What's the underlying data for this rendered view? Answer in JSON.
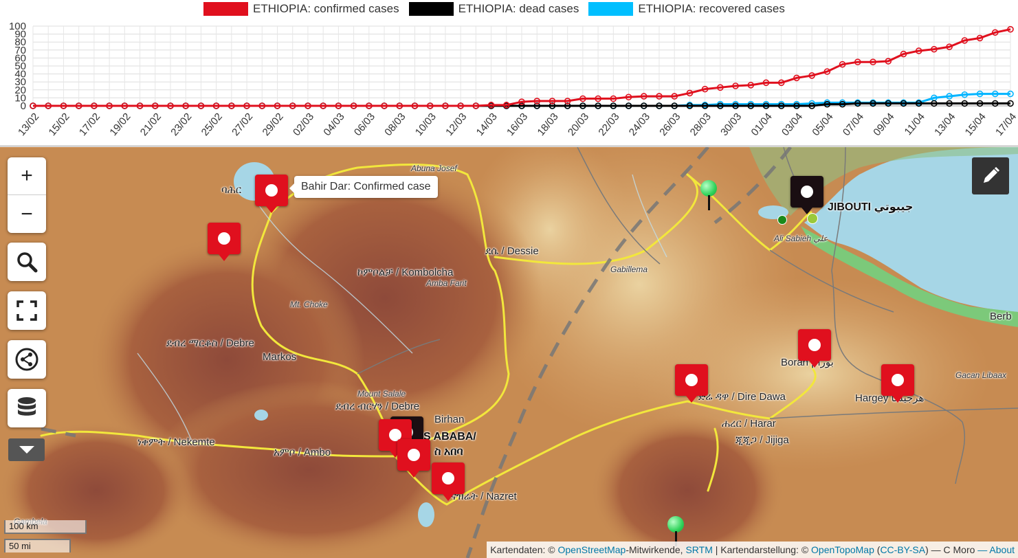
{
  "legend": {
    "confirmed": "ETHIOPIA: confirmed cases",
    "dead": "ETHIOPIA: dead cases",
    "recovered": "ETHIOPIA: recovered cases"
  },
  "chart_data": {
    "type": "line",
    "title": "",
    "xlabel": "",
    "ylabel": "",
    "ylim": [
      0,
      100
    ],
    "yticks": [
      0,
      10,
      20,
      30,
      40,
      50,
      60,
      70,
      80,
      90,
      100
    ],
    "grid": true,
    "legend_position": "top",
    "x": [
      "13/02",
      "14/02",
      "15/02",
      "16/02",
      "17/02",
      "18/02",
      "19/02",
      "20/02",
      "21/02",
      "22/02",
      "23/02",
      "24/02",
      "25/02",
      "26/02",
      "27/02",
      "28/02",
      "29/02",
      "01/03",
      "02/03",
      "03/03",
      "04/03",
      "05/03",
      "06/03",
      "07/03",
      "08/03",
      "09/03",
      "10/03",
      "11/03",
      "12/03",
      "13/03",
      "14/03",
      "15/03",
      "16/03",
      "17/03",
      "18/03",
      "19/03",
      "20/03",
      "21/03",
      "22/03",
      "23/03",
      "24/03",
      "25/03",
      "26/03",
      "27/03",
      "28/03",
      "29/03",
      "30/03",
      "31/03",
      "01/04",
      "02/04",
      "03/04",
      "04/04",
      "05/04",
      "06/04",
      "07/04",
      "08/04",
      "09/04",
      "10/04",
      "11/04",
      "12/04",
      "13/04",
      "14/04",
      "15/04",
      "16/04",
      "17/04"
    ],
    "x_tick_labels": [
      "13/02",
      "15/02",
      "17/02",
      "19/02",
      "21/02",
      "23/02",
      "25/02",
      "27/02",
      "29/02",
      "02/03",
      "04/03",
      "06/03",
      "08/03",
      "10/03",
      "12/03",
      "14/03",
      "16/03",
      "18/03",
      "20/03",
      "22/03",
      "24/03",
      "26/03",
      "28/03",
      "30/03",
      "01/04",
      "03/04",
      "05/04",
      "07/04",
      "09/04",
      "11/04",
      "13/04",
      "15/04",
      "17/04"
    ],
    "series": [
      {
        "name": "ETHIOPIA: confirmed cases",
        "color": "#e0101e",
        "values": [
          0,
          0,
          0,
          0,
          0,
          0,
          0,
          0,
          0,
          0,
          0,
          0,
          0,
          0,
          0,
          0,
          0,
          0,
          0,
          0,
          0,
          0,
          0,
          0,
          0,
          0,
          0,
          0,
          0,
          0,
          1,
          1,
          5,
          6,
          6,
          6,
          9,
          9,
          9,
          11,
          12,
          12,
          12,
          16,
          21,
          23,
          25,
          26,
          29,
          29,
          35,
          38,
          43,
          52,
          55,
          55,
          56,
          65,
          69,
          71,
          74,
          82,
          85,
          92,
          96
        ]
      },
      {
        "name": "ETHIOPIA: dead cases",
        "color": "#000000",
        "values": [
          0,
          0,
          0,
          0,
          0,
          0,
          0,
          0,
          0,
          0,
          0,
          0,
          0,
          0,
          0,
          0,
          0,
          0,
          0,
          0,
          0,
          0,
          0,
          0,
          0,
          0,
          0,
          0,
          0,
          0,
          0,
          0,
          0,
          0,
          0,
          0,
          0,
          0,
          0,
          0,
          0,
          0,
          0,
          0,
          0,
          0,
          0,
          0,
          0,
          0,
          0,
          0,
          2,
          2,
          3,
          3,
          3,
          3,
          3,
          3,
          3,
          3,
          3,
          3,
          3
        ]
      },
      {
        "name": "ETHIOPIA: recovered cases",
        "color": "#00b4ff",
        "values": [
          0,
          0,
          0,
          0,
          0,
          0,
          0,
          0,
          0,
          0,
          0,
          0,
          0,
          0,
          0,
          0,
          0,
          0,
          0,
          0,
          0,
          0,
          0,
          0,
          0,
          0,
          0,
          0,
          0,
          0,
          0,
          0,
          0,
          0,
          0,
          0,
          0,
          0,
          0,
          0,
          0,
          0,
          0,
          1,
          1,
          2,
          2,
          2,
          2,
          2,
          2,
          3,
          4,
          4,
          4,
          4,
          4,
          4,
          4,
          10,
          12,
          14,
          15,
          15,
          15
        ]
      }
    ]
  },
  "map": {
    "tooltip": "Bahir Dar: Confirmed case",
    "places": [
      {
        "text": "Abuna Josef",
        "cls": "small"
      },
      {
        "text": "ባሕር",
        "cls": ""
      },
      {
        "text": "ደሴ / Dessie",
        "cls": ""
      },
      {
        "text": "ኮምቦልቻ / Kombolcha",
        "cls": ""
      },
      {
        "text": "Amba Farit",
        "cls": "small"
      },
      {
        "text": "Mt. Choke",
        "cls": "small"
      },
      {
        "text": "ደብረ ማርቆስ / Debre",
        "cls": ""
      },
      {
        "text": "Markos",
        "cls": ""
      },
      {
        "text": "Mount Salale",
        "cls": "small"
      },
      {
        "text": "ደብረ ብርሃን / Debre",
        "cls": ""
      },
      {
        "text": "Birhan",
        "cls": ""
      },
      {
        "text": "DIS ABABA/",
        "cls": "big"
      },
      {
        "text": "ስ አበባ",
        "cls": "big"
      },
      {
        "text": "ነቀምት / Nekemte",
        "cls": ""
      },
      {
        "text": "አምቦ / Ambo",
        "cls": ""
      },
      {
        "text": "ናዝሬት / Nazret",
        "cls": ""
      },
      {
        "text": "Gabillema",
        "cls": "small"
      },
      {
        "text": "JIBOUTI جيبوتي",
        "cls": "big"
      },
      {
        "text": "Ali Sabieh علي",
        "cls": "small"
      },
      {
        "text": "ድሬ ዳዋ / Dire Dawa",
        "cls": ""
      },
      {
        "text": "ሐረር / Harar",
        "cls": ""
      },
      {
        "text": "ጂጂጋ / Jijiga",
        "cls": ""
      },
      {
        "text": "Boran بورام",
        "cls": ""
      },
      {
        "text": "Hargey هرجيسا",
        "cls": ""
      },
      {
        "text": "Gacan Libaax",
        "cls": "small"
      },
      {
        "text": "Berb",
        "cls": ""
      },
      {
        "text": "Gambela",
        "cls": "small"
      }
    ],
    "scale_km": "100 km",
    "scale_mi": "50 mi"
  },
  "controls": {
    "zoom_in": "+",
    "zoom_out": "−"
  },
  "attribution": {
    "prefix": "Kartendaten: ©",
    "osm": "OpenStreetMap",
    "mid1": "-Mitwirkende,",
    "srtm": "SRTM",
    "mid2": "| Kartendarstellung: ©",
    "otm": "OpenTopoMap",
    "license_open": "(",
    "license": "CC-BY-SA",
    "license_close": ") — C Moro",
    "about": "— About"
  },
  "colors": {
    "map_land": "#c98a4e",
    "map_highland": "#a65d40",
    "map_lowland": "#e0b27a",
    "sea": "#a6d6e6",
    "marker_red": "#e0101e",
    "marker_black": "#1a0e12",
    "road": "#f2e73c"
  }
}
